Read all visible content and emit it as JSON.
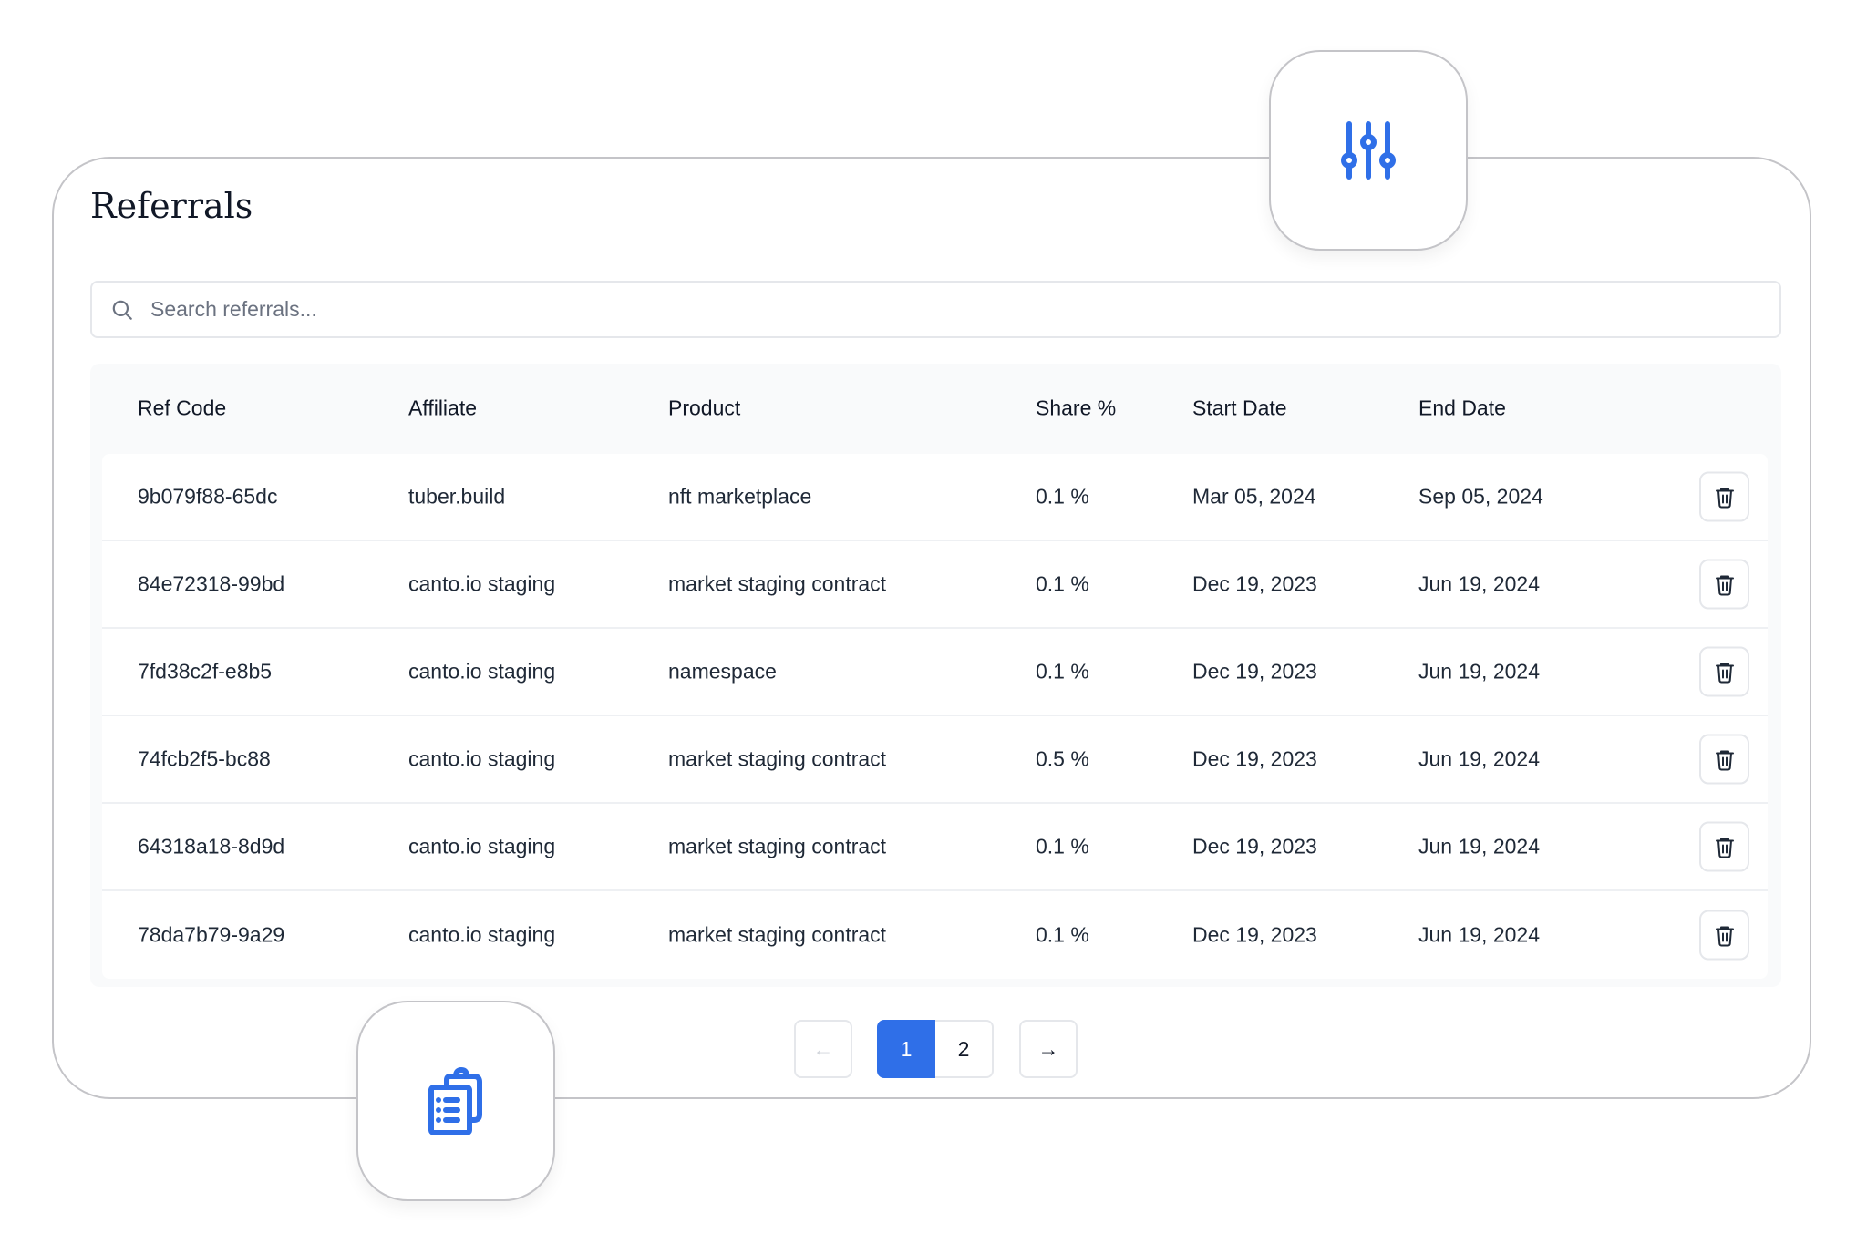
{
  "title": "Referrals",
  "search": {
    "placeholder": "Search referrals..."
  },
  "columns": [
    "Ref Code",
    "Affiliate",
    "Product",
    "Share %",
    "Start Date",
    "End Date"
  ],
  "rows": [
    [
      "9b079f88-65dc",
      "tuber.build",
      "nft marketplace",
      "0.1 %",
      "Mar 05, 2024",
      "Sep 05, 2024"
    ],
    [
      "84e72318-99bd",
      "canto.io staging",
      "market staging contract",
      "0.1 %",
      "Dec 19, 2023",
      "Jun 19, 2024"
    ],
    [
      "7fd38c2f-e8b5",
      "canto.io staging",
      "namespace",
      "0.1 %",
      "Dec 19, 2023",
      "Jun 19, 2024"
    ],
    [
      "74fcb2f5-bc88",
      "canto.io staging",
      "market staging contract",
      "0.5 %",
      "Dec 19, 2023",
      "Jun 19, 2024"
    ],
    [
      "64318a18-8d9d",
      "canto.io staging",
      "market staging contract",
      "0.1 %",
      "Dec 19, 2023",
      "Jun 19, 2024"
    ],
    [
      "78da7b79-9a29",
      "canto.io staging",
      "market staging contract",
      "0.1 %",
      "Dec 19, 2023",
      "Jun 19, 2024"
    ]
  ],
  "pagination": {
    "pages": [
      "1",
      "2"
    ],
    "current": "1",
    "prev": "←",
    "next": "→"
  },
  "colors": {
    "accent": "#2f6fe8",
    "border": "#e5e7eb",
    "text": "#1f2937"
  },
  "icons": {
    "filter": "sliders-icon",
    "clipboard": "clipboard-list-icon",
    "delete": "trash-icon",
    "search": "search-icon"
  }
}
